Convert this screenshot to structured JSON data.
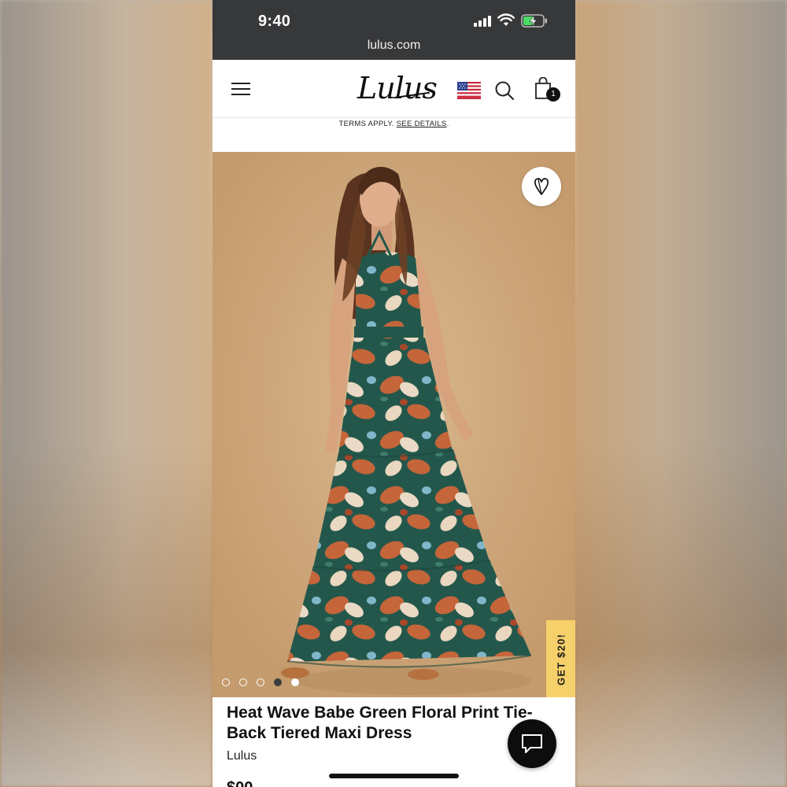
{
  "status_bar": {
    "time": "9:40",
    "url": "lulus.com",
    "icons": [
      "cellular-signal-icon",
      "wifi-icon",
      "battery-charging-icon"
    ]
  },
  "header": {
    "logo_text": "Lulus",
    "icons": [
      "hamburger-menu-icon",
      "us-flag-icon",
      "search-icon",
      "shopping-bag-icon"
    ],
    "cart_count": "1"
  },
  "promo": {
    "text": "TERMS APPLY.",
    "link_label": "SEE DETAILS",
    "suffix": "."
  },
  "gallery": {
    "favorite_icon": "heart-icon",
    "image_count": 5,
    "active_index": 3
  },
  "side_tab": {
    "label": "GET $20!"
  },
  "product": {
    "title": "Heat Wave Babe Green Floral Print Tie-Back Tiered Maxi Dress",
    "brand": "Lulus",
    "price_partial": "$00"
  },
  "chat": {
    "icon": "chat-bubble-icon"
  },
  "colors": {
    "status_bar_bg": "#37383a",
    "promo_tab": "#f6d06a",
    "dress_green": "#24574c",
    "dress_rust": "#c5653a"
  }
}
